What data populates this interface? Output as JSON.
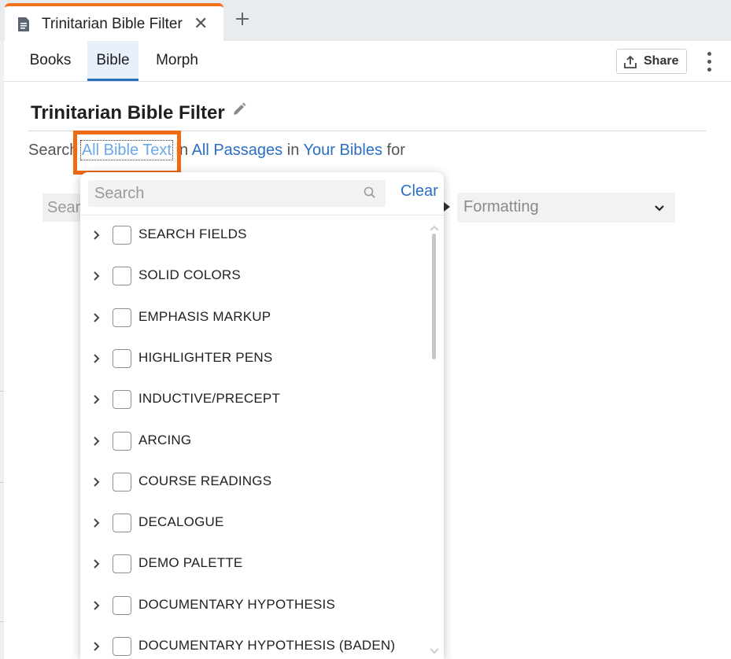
{
  "tab": {
    "title": "Trinitarian Bible Filter",
    "close": "✕"
  },
  "navtabs": [
    {
      "label": "Books"
    },
    {
      "label": "Bible"
    },
    {
      "label": "Morph"
    }
  ],
  "toolbar": {
    "share_label": "Share"
  },
  "page": {
    "title": "Trinitarian Bible Filter"
  },
  "search_line": {
    "prefix": "Search",
    "scope": "All Bible Text",
    "in1": "in",
    "passages": "All Passages",
    "in2": "in",
    "bibles": "Your Bibles",
    "suffix": "for"
  },
  "search_ghost": "Sear",
  "formatting": {
    "label": "Formatting"
  },
  "dropdown": {
    "search_placeholder": "Search",
    "clear_label": "Clear",
    "items": [
      {
        "label": "SEARCH FIELDS",
        "checked": false
      },
      {
        "label": "SOLID COLORS",
        "checked": false
      },
      {
        "label": "EMPHASIS MARKUP",
        "checked": false
      },
      {
        "label": "HIGHLIGHTER PENS",
        "checked": false
      },
      {
        "label": "INDUCTIVE/PRECEPT",
        "checked": false
      },
      {
        "label": "ARCING",
        "checked": false
      },
      {
        "label": "COURSE READINGS",
        "checked": false
      },
      {
        "label": "DECALOGUE",
        "checked": false
      },
      {
        "label": "DEMO PALETTE",
        "checked": false
      },
      {
        "label": "DOCUMENTARY HYPOTHESIS",
        "checked": false
      },
      {
        "label": "DOCUMENTARY HYPOTHESIS (BADEN)",
        "checked": false
      }
    ]
  },
  "colors": {
    "accent": "#2b6fc4",
    "highlight": "#f06a13",
    "tab_accent": "#f07321"
  }
}
